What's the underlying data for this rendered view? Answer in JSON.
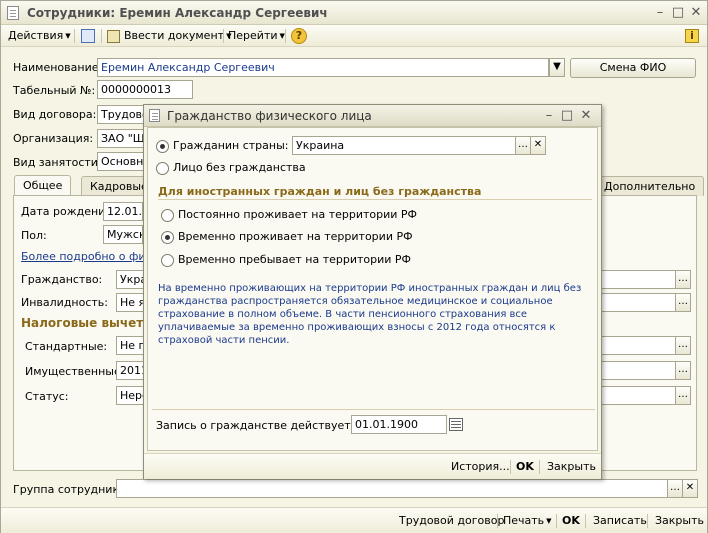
{
  "window": {
    "title": "Сотрудники: Еремин Александр Сергеевич"
  },
  "toolbar": {
    "actions": "Действия",
    "enter_doc": "Ввести документ",
    "go": "Перейти"
  },
  "form": {
    "name_label": "Наименование:",
    "name_value": "Еремин Александр Сергеевич",
    "change_fio": "Смена ФИО",
    "tab_label": "Табельный №:",
    "tab_value": "0000000013",
    "contract_label": "Вид договора:",
    "contract_value": "Трудово",
    "org_label": "Организация:",
    "org_value": "ЗАО \"Ш",
    "employment_label": "Вид занятости:",
    "employment_value": "Основно"
  },
  "tabs": {
    "general": "Общее",
    "personnel": "Кадровые",
    "extra": "Дополнительно"
  },
  "general": {
    "birth_label": "Дата рождения:",
    "birth_value": "12.01.1",
    "sex_label": "Пол:",
    "sex_value": "Мужск",
    "more_link": "Более подробно о физи",
    "citizenship_label": "Гражданство:",
    "citizenship_value": "Укра",
    "disability_label": "Инвалидность:",
    "disability_value": "Не я",
    "tax_header": "Налоговые вычеты,",
    "standard_label": "Стандартные:",
    "standard_value": "Не п",
    "property_label": "Имущественные:",
    "property_value": "2011",
    "status_label": "Статус:",
    "status_value": "Нере"
  },
  "group": {
    "label": "Группа сотрудника:",
    "value": ""
  },
  "bottom": {
    "labor": "Трудовой договор",
    "print": "Печать",
    "ok": "OK",
    "save": "Записать",
    "close": "Закрыть"
  },
  "dialog": {
    "title": "Гражданство физического лица",
    "citizen_label": "Гражданин страны:",
    "country_value": "Украина",
    "stateless_label": "Лицо без гражданства",
    "foreign_header": "Для иностранных граждан и лиц без гражданства",
    "opt_permanent": "Постоянно проживает на территории РФ",
    "opt_temporary": "Временно проживает на территории РФ",
    "opt_staying": "Временно пребывает на территории РФ",
    "note": "На временно проживающих на территории РФ иностранных граждан и лиц без гражданства распространяется обязательное медицинское и социальное страхование в полном объеме. В части пенсионного страхования все уплачиваемые за временно проживающих взносы с 2012 года относятся к страховой части пенсии.",
    "record_label": "Запись о гражданстве действует с:",
    "record_date": "01.01.1900",
    "history": "История...",
    "ok": "OK",
    "close": "Закрыть"
  }
}
